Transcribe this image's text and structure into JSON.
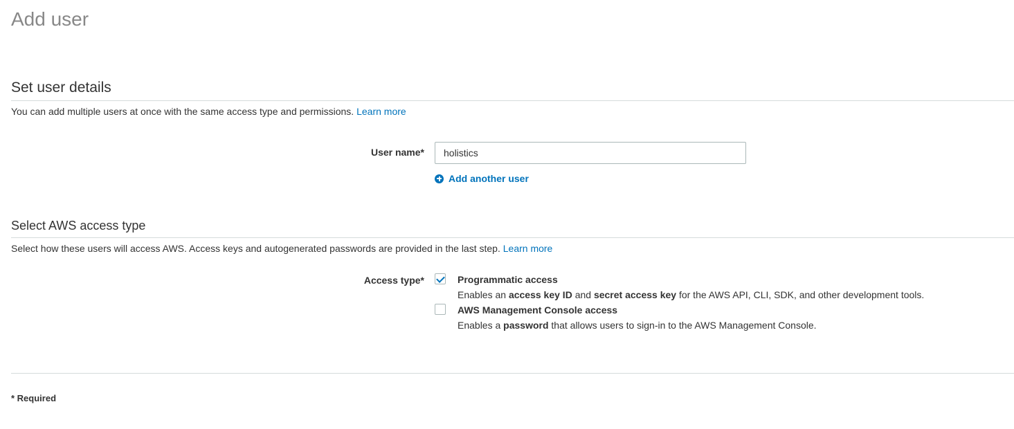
{
  "page": {
    "title": "Add user"
  },
  "details": {
    "title": "Set user details",
    "description": "You can add multiple users at once with the same access type and permissions.",
    "learn_more": "Learn more",
    "user_name_label": "User name*",
    "user_name_value": "holistics",
    "add_another_user": "Add another user"
  },
  "access": {
    "title": "Select AWS access type",
    "description": "Select how these users will access AWS. Access keys and autogenerated passwords are provided in the last step.",
    "learn_more": "Learn more",
    "access_type_label": "Access type*",
    "options": [
      {
        "title": "Programmatic access",
        "checked": true,
        "desc_prefix": "Enables an ",
        "desc_bold1": "access key ID",
        "desc_mid": " and ",
        "desc_bold2": "secret access key",
        "desc_suffix": " for the AWS API, CLI, SDK, and other development tools."
      },
      {
        "title": "AWS Management Console access",
        "checked": false,
        "desc_prefix": "Enables a ",
        "desc_bold1": "password",
        "desc_suffix": " that allows users to sign-in to the AWS Management Console."
      }
    ]
  },
  "footer": {
    "required_note": "* Required"
  },
  "colors": {
    "link": "#0073bb",
    "title_gray": "#888888"
  },
  "icons": {
    "add_user_icon": "plus-circle-icon",
    "checkbox_checked": "checkmark-icon"
  }
}
